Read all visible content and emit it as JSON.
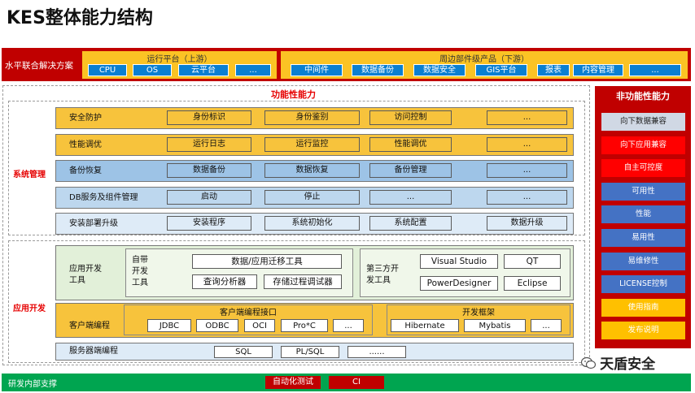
{
  "title": "KES整体能力结构",
  "horizontal": {
    "label": "水平联合解决方案",
    "runtime": {
      "title": "运行平台（上游）",
      "items": [
        "CPU",
        "OS",
        "云平台",
        "..."
      ]
    },
    "peripheral": {
      "title": "周边部件级产品（下游）",
      "items": [
        "中间件",
        "数据备份",
        "数据安全",
        "GIS平台",
        "报表",
        "内容管理",
        "..."
      ]
    }
  },
  "functional": {
    "title": "功能性能力",
    "system_mgmt": {
      "label": "系统管理",
      "rows": [
        {
          "label": "安全防护",
          "items": [
            "身份标识",
            "身份鉴别",
            "访问控制",
            "..."
          ]
        },
        {
          "label": "性能调优",
          "items": [
            "运行日志",
            "运行监控",
            "性能调优",
            "..."
          ]
        },
        {
          "label": "备份恢复",
          "items": [
            "数据备份",
            "数据恢复",
            "备份管理",
            "..."
          ]
        },
        {
          "label": "DB服务及组件管理",
          "items": [
            "启动",
            "停止",
            "...",
            "..."
          ]
        },
        {
          "label": "安装部署升级",
          "items": [
            "安装程序",
            "系统初始化",
            "系统配置",
            "数据升级"
          ]
        }
      ]
    },
    "app_dev": {
      "label": "应用开发",
      "tools_label": "应用开发\n工具",
      "builtin_label": "自带\n开发\n工具",
      "builtin_items": [
        "数据/应用迁移工具",
        "查询分析器",
        "存储过程调试器"
      ],
      "third_label": "第三方开\n发工具",
      "third_items": [
        "Visual Studio",
        "QT",
        "PowerDesigner",
        "Eclipse"
      ],
      "client_label": "客户端编程",
      "client_iface_title": "客户端编程接口",
      "client_iface_items": [
        "JDBC",
        "ODBC",
        "OCI",
        "Pro*C",
        "..."
      ],
      "framework_title": "开发框架",
      "framework_items": [
        "Hibernate",
        "Mybatis",
        "..."
      ],
      "server_label": "服务器端编程",
      "server_items": [
        "SQL",
        "PL/SQL",
        "......"
      ]
    }
  },
  "nonfunctional": {
    "title": "非功能性能力",
    "items": [
      {
        "label": "向下数据兼容",
        "color": "#d0d8e4",
        "text": "#222222"
      },
      {
        "label": "向下应用兼容",
        "color": "#ff0000",
        "text": "#ffffff"
      },
      {
        "label": "自主可控度",
        "color": "#ff0000",
        "text": "#ffffff"
      },
      {
        "label": "可用性",
        "color": "#4472c4",
        "text": "#ffffff"
      },
      {
        "label": "性能",
        "color": "#4472c4",
        "text": "#ffffff"
      },
      {
        "label": "易用性",
        "color": "#4472c4",
        "text": "#ffffff"
      },
      {
        "label": "易维修性",
        "color": "#4472c4",
        "text": "#ffffff"
      },
      {
        "label": "LICENSE控制",
        "color": "#4472c4",
        "text": "#ffffff"
      },
      {
        "label": "使用指南",
        "color": "#ffc000",
        "text": "#ffffff"
      },
      {
        "label": "发布说明",
        "color": "#ffc000",
        "text": "#ffffff"
      }
    ]
  },
  "bottom": {
    "label": "研发内部支撑",
    "items": [
      "自动化测试",
      "CI"
    ]
  },
  "watermark": "天盾安全",
  "colors": {
    "red": "#c00000",
    "yellow": "#fbc324",
    "blue": "#0a7fd1",
    "green": "#00a550",
    "row_yellow": "#f7c33c",
    "row_blue": "#9dc3e6",
    "row_lightblue": "#bdd7ee",
    "row_paleblue": "#deebf7"
  }
}
